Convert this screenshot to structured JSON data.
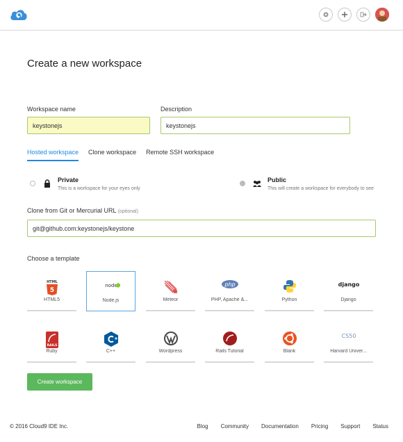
{
  "colors": {
    "accent": "#1e88e5",
    "field_border": "#a6c96a",
    "field_highlight": "#fafac5",
    "primary_button": "#5cb85c",
    "template_selected": "#5aa4e0"
  },
  "header": {
    "logo_icon": "cloud9-logo-icon",
    "icons": [
      "gear-icon",
      "plus-icon",
      "sign-out-icon",
      "avatar"
    ]
  },
  "page": {
    "title": "Create a new workspace"
  },
  "form": {
    "workspace_name": {
      "label": "Workspace name",
      "value": "keystonejs"
    },
    "description": {
      "label": "Description",
      "value": "keystonejs"
    }
  },
  "tabs": [
    {
      "label": "Hosted workspace",
      "active": true
    },
    {
      "label": "Clone workspace",
      "active": false
    },
    {
      "label": "Remote SSH workspace",
      "active": false
    }
  ],
  "visibility": {
    "private": {
      "title": "Private",
      "desc": "This is a workspace for your eyes only",
      "icon": "lock-icon"
    },
    "public": {
      "title": "Public",
      "desc": "This will create a workspace for everybody to see",
      "icon": "users-icon"
    }
  },
  "clone": {
    "label": "Clone from Git or Mercurial URL",
    "optional": "(optional)",
    "value": "git@github.com:keystonejs/keystone"
  },
  "templates": {
    "label": "Choose a template",
    "items": [
      {
        "name": "HTML5",
        "icon": "html5-icon"
      },
      {
        "name": "Node.js",
        "icon": "nodejs-icon",
        "selected": true
      },
      {
        "name": "Meteor",
        "icon": "meteor-icon"
      },
      {
        "name": "PHP, Apache &...",
        "icon": "php-icon"
      },
      {
        "name": "Python",
        "icon": "python-icon"
      },
      {
        "name": "Django",
        "icon": "django-icon"
      },
      {
        "name": "Ruby",
        "icon": "rails-icon"
      },
      {
        "name": "C++",
        "icon": "cpp-icon"
      },
      {
        "name": "Wordpress",
        "icon": "wordpress-icon"
      },
      {
        "name": "Rails Tutorial",
        "icon": "rails-tutorial-icon"
      },
      {
        "name": "Blank",
        "icon": "ubuntu-icon"
      },
      {
        "name": "Harvard Univer...",
        "icon": "cs50-icon"
      }
    ],
    "icon_text": {
      "html5": "HTML",
      "html5_num": "5",
      "node": "node",
      "php": "php",
      "django": "django",
      "rails": "RAILS",
      "cs50": "CS50"
    }
  },
  "actions": {
    "create": "Create workspace"
  },
  "footer": {
    "copyright": "© 2016 Cloud9 IDE Inc.",
    "links": [
      "Blog",
      "Community",
      "Documentation",
      "Pricing",
      "Support",
      "Status"
    ]
  }
}
